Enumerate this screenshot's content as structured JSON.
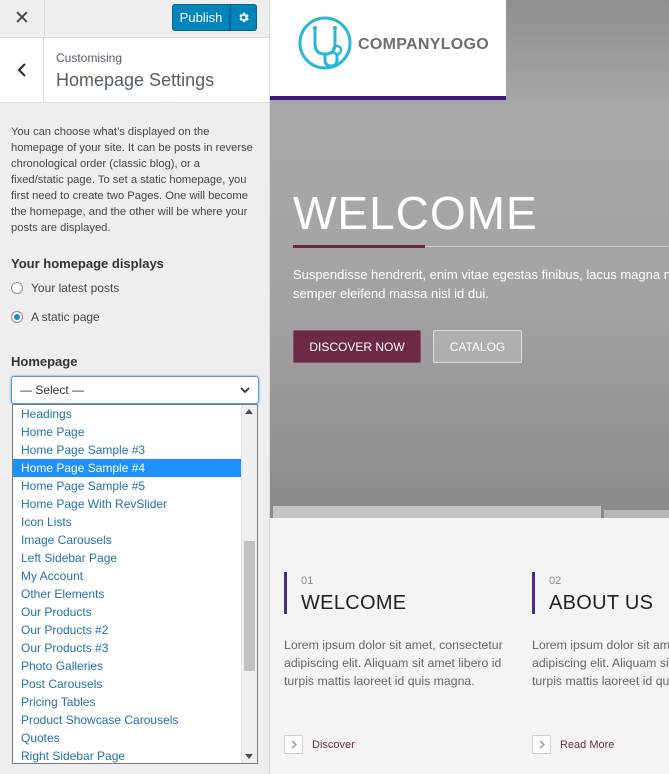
{
  "customizer": {
    "close_icon": "close-icon",
    "publish_label": "Publish",
    "gear_icon": "gear-icon",
    "back_icon": "chevron-left-icon",
    "section_kicker": "Customising",
    "section_title": "Homepage Settings",
    "description": "You can choose what’s displayed on the homepage of your site. It can be posts in reverse chronological order (classic blog), or a fixed/static page. To set a static homepage, you first need to create two Pages. One will become the homepage, and the other will be where your posts are displayed.",
    "displays_label": "Your homepage displays",
    "radio_options": [
      {
        "label": "Your latest posts",
        "checked": false
      },
      {
        "label": "A static page",
        "checked": true
      }
    ],
    "homepage_label": "Homepage",
    "select_value": "— Select —",
    "dropdown_items": [
      "Headings",
      "Home Page",
      "Home Page Sample #3",
      "Home Page Sample #4",
      "Home Page Sample #5",
      "Home Page With RevSlider",
      "Icon Lists",
      "Image Carousels",
      "Left Sidebar Page",
      "My Account",
      "Other Elements",
      "Our Products",
      "Our Products #2",
      "Our Products #3",
      "Photo Galleries",
      "Post Carousels",
      "Pricing Tables",
      "Product Showcase Carousels",
      "Quotes",
      "Right Sidebar Page"
    ],
    "dropdown_selected": "Home Page Sample #4"
  },
  "preview": {
    "logo_text": "COMPANYLOGO",
    "hero_title": "WELCOME",
    "hero_text": "Suspendisse hendrerit, enim vitae egestas finibus, lacus magna nisl, semper eleifend massa nisl id dui.",
    "btn_discover": "DISCOVER NOW",
    "btn_catalog": "CATALOG",
    "columns": [
      {
        "num": "01",
        "title": "WELCOME",
        "text": "Lorem ipsum dolor sit amet, consectetur adipiscing elit. Aliquam sit amet libero id turpis mattis laoreet id quis magna.",
        "link": "Discover"
      },
      {
        "num": "02",
        "title": "ABOUT US",
        "text": "Lorem ipsum dolor sit amet, consectetur adipiscing elit. Aliquam sit amet libero id turpis mattis laoreet id quis magna.",
        "link": "Read More"
      }
    ]
  },
  "colors": {
    "publish_blue": "#0085ba",
    "accent_purple": "#4a2a85",
    "accent_wine": "#6d2a47",
    "selected_item": "#1e90ff"
  }
}
